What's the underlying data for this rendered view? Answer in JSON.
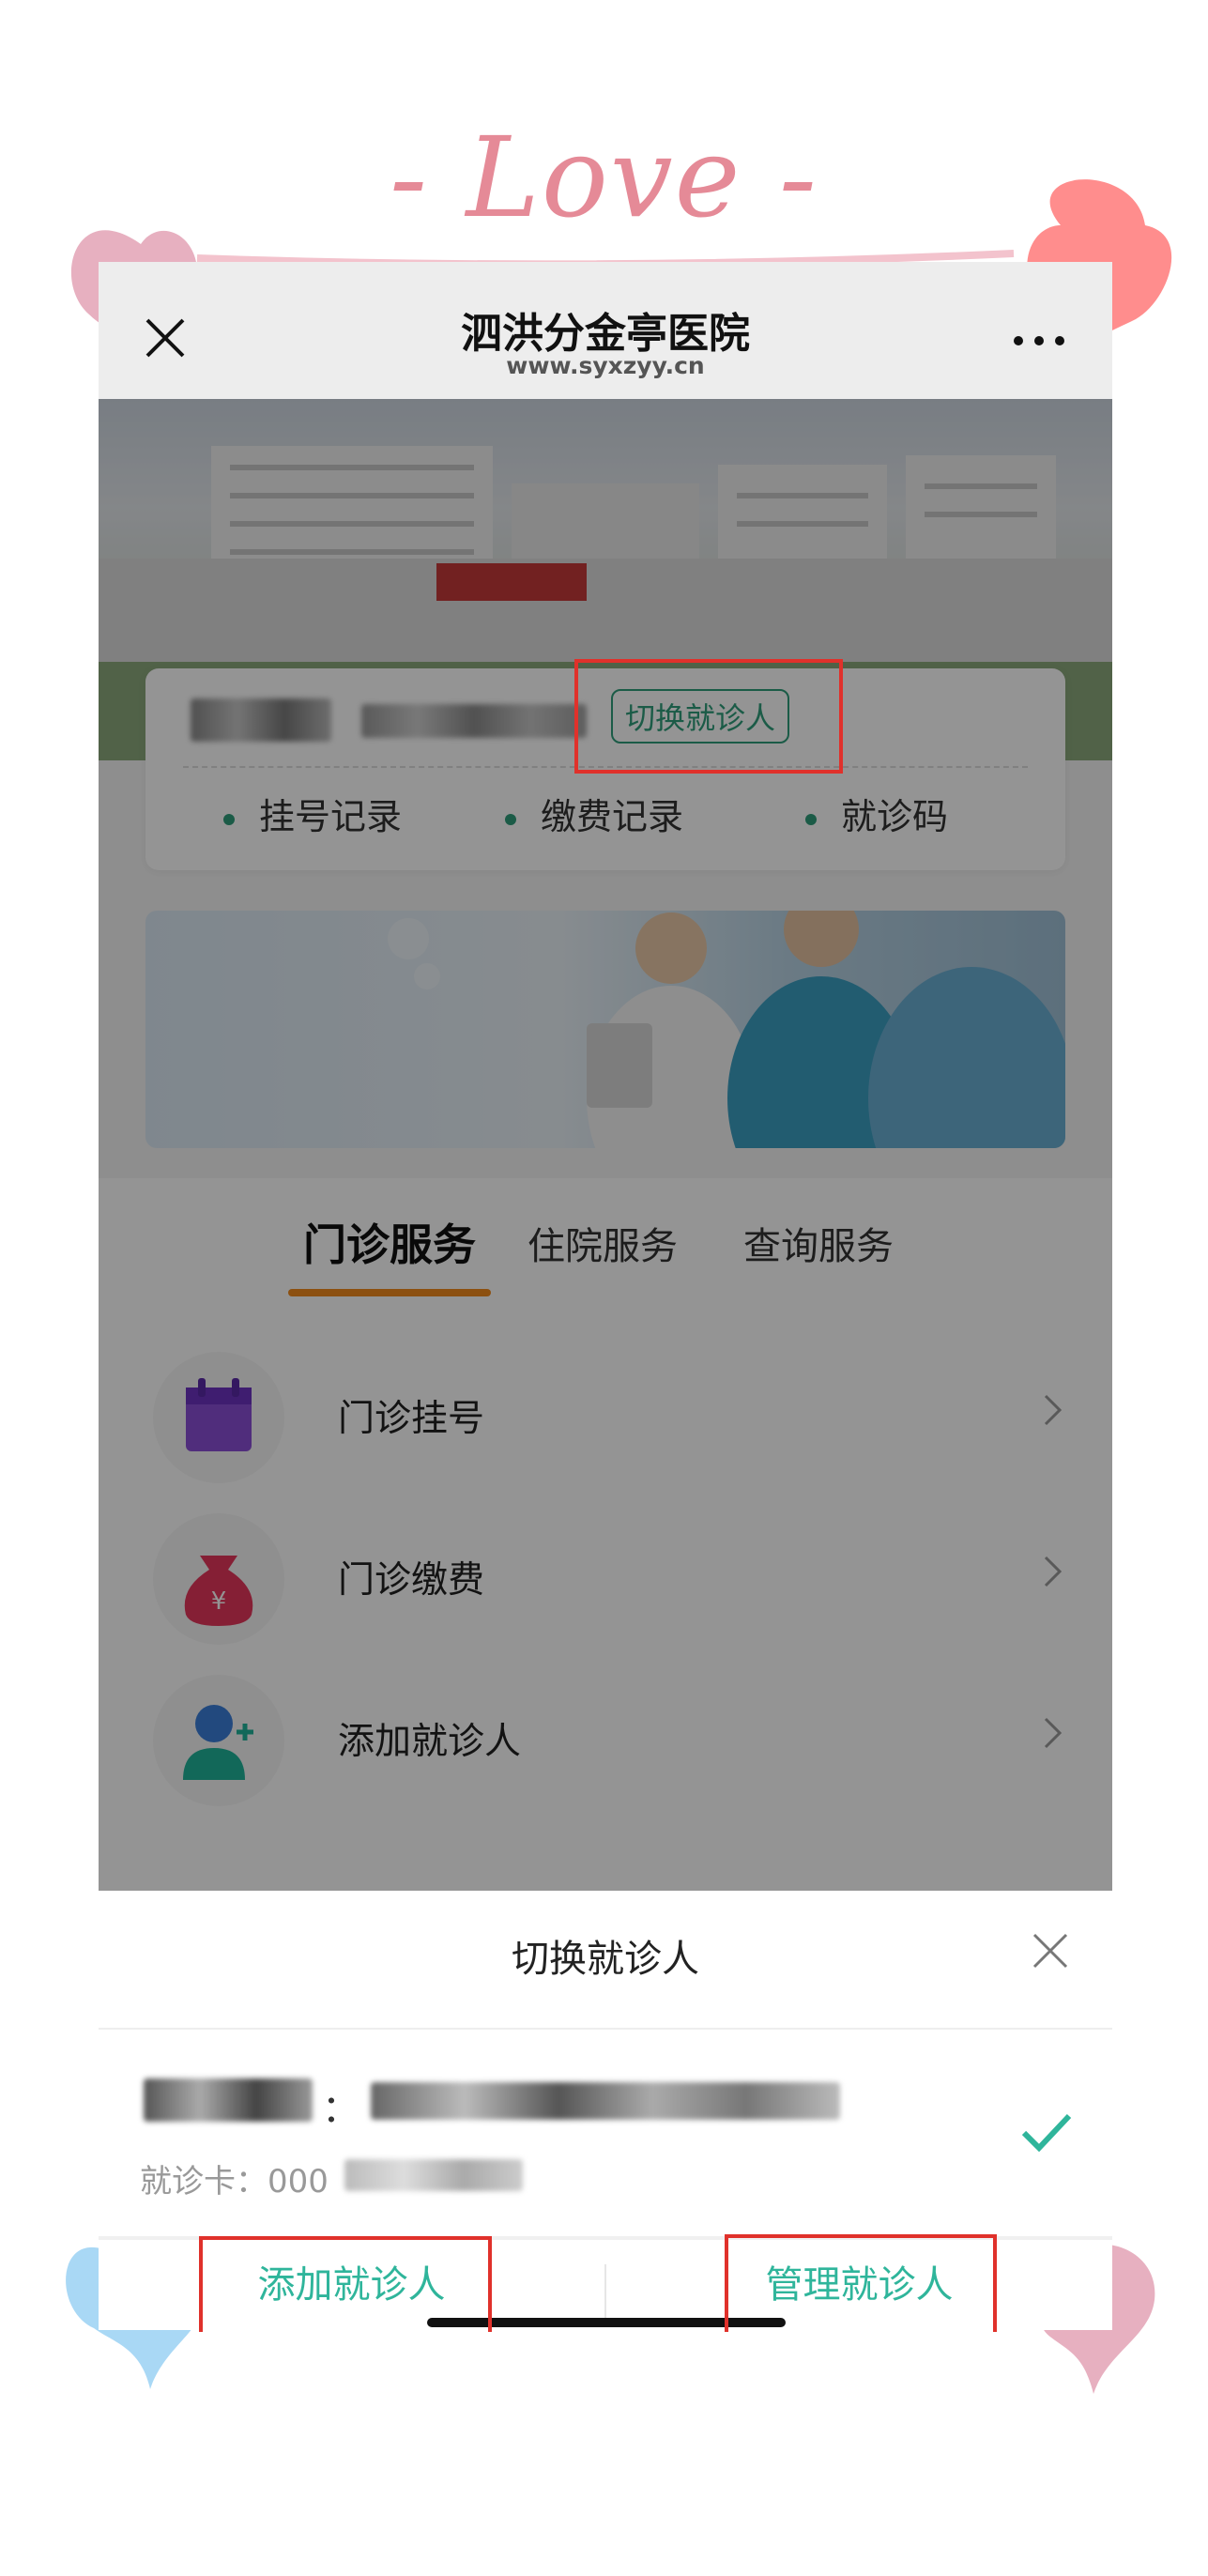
{
  "decoration": {
    "love_text": "- Love -",
    "colors": {
      "pink": "#e8b3c2",
      "coral": "#ff8a8a",
      "blue": "#a9d8f5"
    }
  },
  "header": {
    "title": "泗洪分金亭医院",
    "url": "www.syxzyy.cn",
    "close_icon": "close-icon",
    "more_icon": "more-icon"
  },
  "patient_card": {
    "switch_label": "切换就诊人",
    "quick_links": [
      {
        "label": "挂号记录"
      },
      {
        "label": "缴费记录"
      },
      {
        "label": "就诊码"
      }
    ]
  },
  "tabs": [
    {
      "label": "门诊服务",
      "active": true
    },
    {
      "label": "住院服务",
      "active": false
    },
    {
      "label": "查询服务",
      "active": false
    }
  ],
  "services": [
    {
      "label": "门诊挂号",
      "icon": "calendar-icon"
    },
    {
      "label": "门诊缴费",
      "icon": "money-bag-icon"
    },
    {
      "label": "添加就诊人",
      "icon": "add-user-icon"
    }
  ],
  "bottom_sheet": {
    "title": "切换就诊人",
    "card_label": "就诊卡：",
    "card_prefix": "000",
    "colon": "：",
    "add_label": "添加就诊人",
    "manage_label": "管理就诊人"
  },
  "colors": {
    "accent_green": "#2f9e7a",
    "sheet_green": "#2fb59b",
    "tab_underline": "#f28a1c",
    "highlight_red": "#e0312b"
  }
}
